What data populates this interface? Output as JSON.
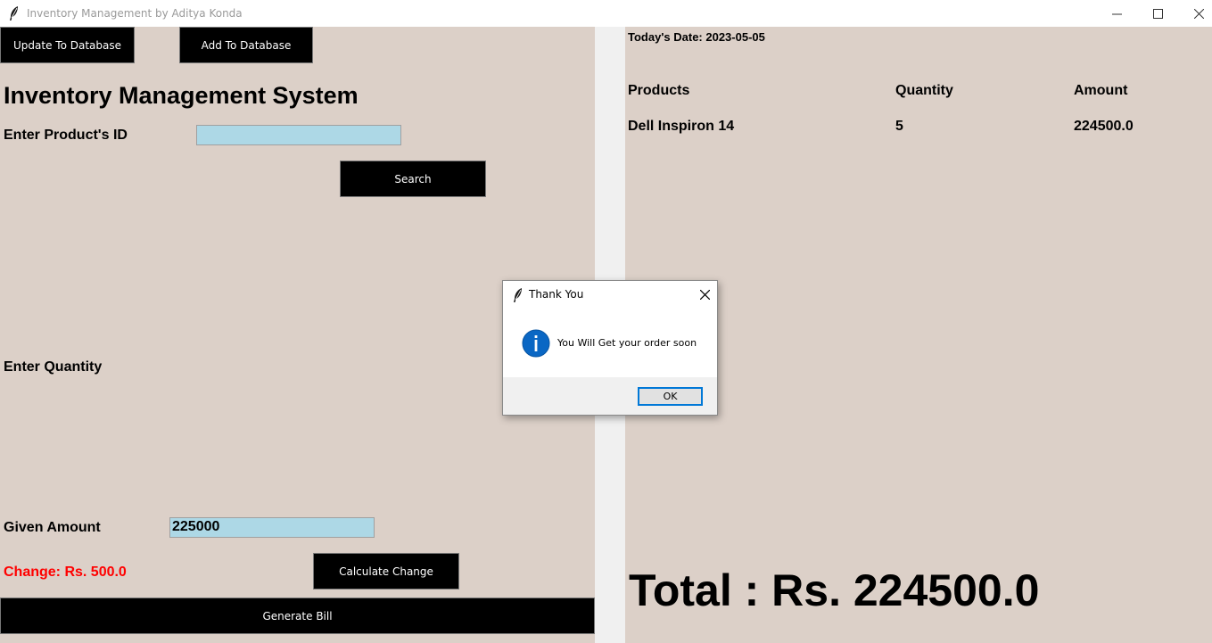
{
  "window": {
    "title": "Inventory Management by Aditya Konda"
  },
  "toolbar": {
    "update_label": "Update To Database",
    "add_label": "Add To Database"
  },
  "main": {
    "heading": "Inventory Management System",
    "product_id_label": "Enter Product's ID",
    "product_id_value": "",
    "search_label": "Search",
    "quantity_label": "Enter Quantity",
    "given_amount_label": "Given Amount",
    "given_amount_value": "225000",
    "change_text": "Change: Rs. 500.0",
    "calculate_label": "Calculate Change",
    "generate_label": "Generate Bill"
  },
  "bill": {
    "date": "Today's Date: 2023-05-05",
    "headers": [
      "Products",
      "Quantity",
      "Amount"
    ],
    "rows": [
      {
        "product": "Dell Inspiron 14",
        "quantity": "5",
        "amount": "224500.0"
      }
    ],
    "total": "Total : Rs. 224500.0"
  },
  "dialog": {
    "title": "Thank You",
    "message": "You Will Get your order soon",
    "ok_label": "OK"
  },
  "colors": {
    "panel_bg": "#dcd0c8",
    "field_bg": "#add8e6",
    "change_text": "#ff0000",
    "button_bg": "#000000",
    "info_icon": "#0a67c4"
  },
  "icons": [
    "feather-icon",
    "minimize-icon",
    "maximize-icon",
    "close-icon",
    "info-icon"
  ]
}
